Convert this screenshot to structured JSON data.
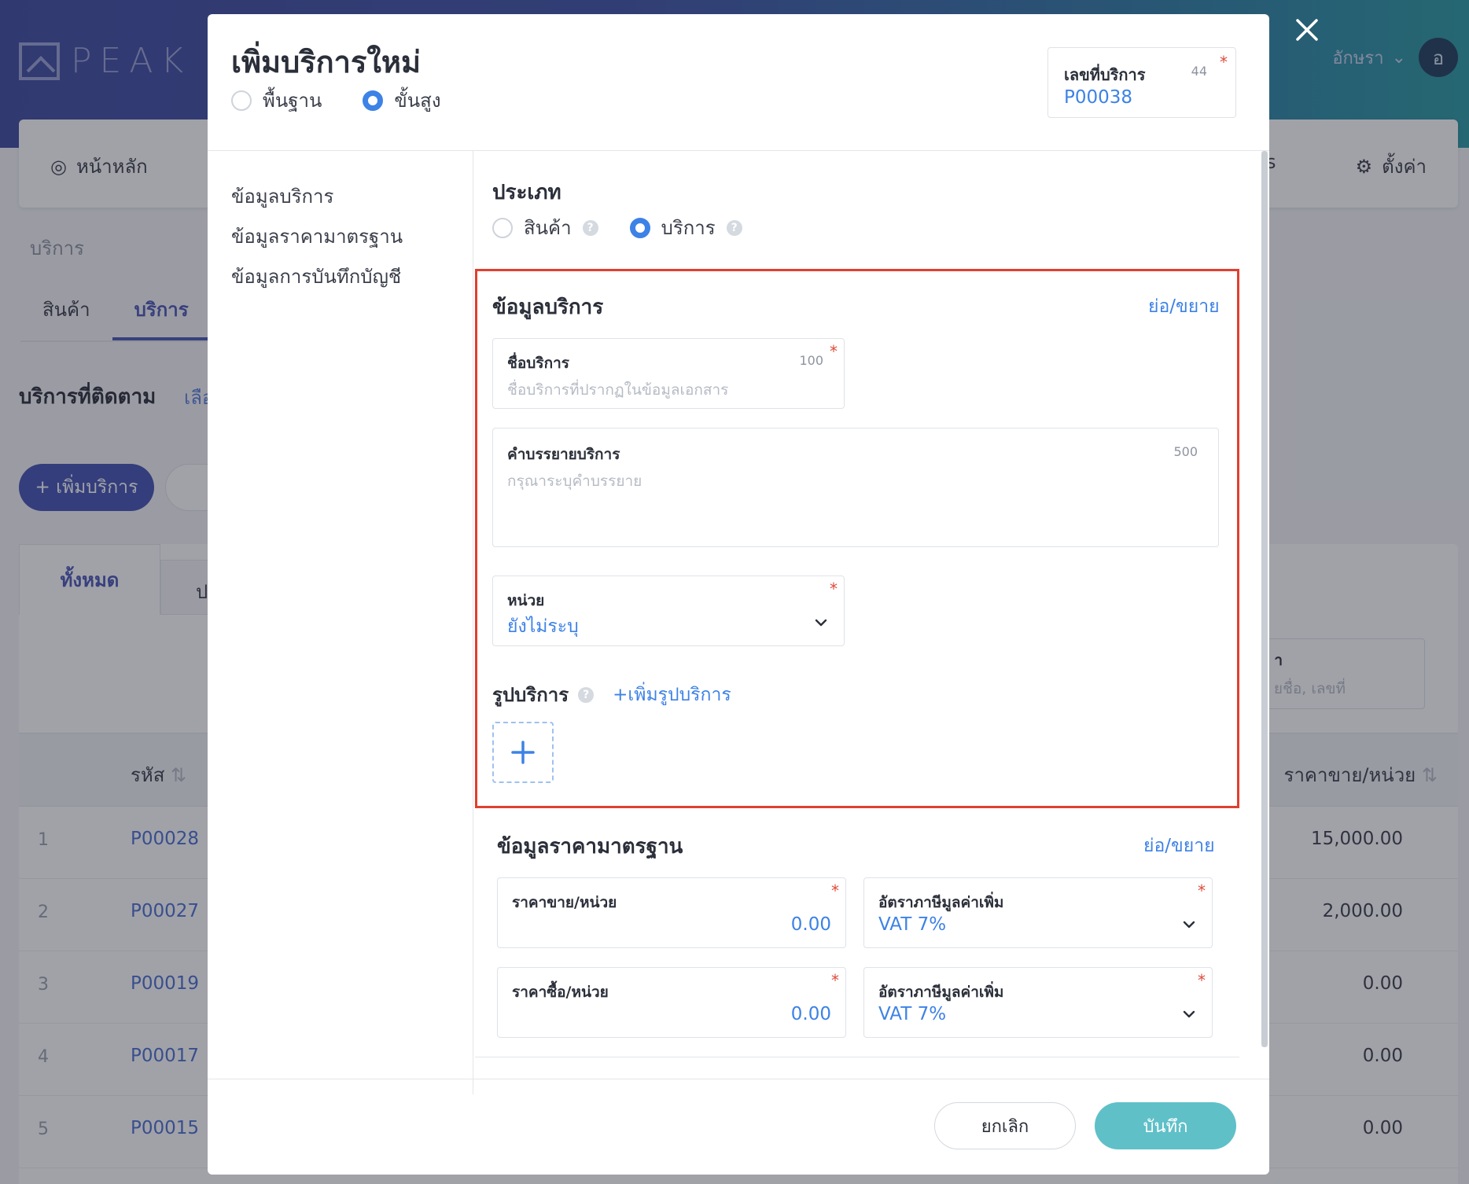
{
  "background": {
    "logo_text": "PEAK",
    "user_name": "อักษรา",
    "avatar_letter": "อ",
    "nav_home": "หน้าหลัก",
    "nav_settings": "ตั้งค่า",
    "nav_partial": "s",
    "breadcrumb": "บริการ",
    "tabs": [
      "สินค้า",
      "บริการ"
    ],
    "followed_title": "บริการที่ติดตาม",
    "followed_link": "เลือ",
    "add_button": "+ เพิ่มบริการ",
    "subtab_all": "ทั้งหมด",
    "subtab_partial": "ป",
    "search_partial_label": "า",
    "search_partial_placeholder": "ยชื่อ, เลขที่",
    "table_head_code": "รหัส",
    "table_head_price": "ราคาขาย/หน่วย",
    "rows": [
      {
        "idx": "1",
        "code": "P00028",
        "price": "15,000.00"
      },
      {
        "idx": "2",
        "code": "P00027",
        "price": "2,000.00"
      },
      {
        "idx": "3",
        "code": "P00019",
        "price": "0.00"
      },
      {
        "idx": "4",
        "code": "P00017",
        "price": "0.00"
      },
      {
        "idx": "5",
        "code": "P00015",
        "price": "0.00"
      }
    ]
  },
  "modal": {
    "title": "เพิ่มบริการใหม่",
    "mode_basic": "พื้นฐาน",
    "mode_advanced": "ขั้นสูง",
    "mode_selected": "advanced",
    "doc_number_label": "เลขที่บริการ",
    "doc_number_count": "44",
    "doc_number_value": "P00038",
    "side_nav": [
      "ข้อมูลบริการ",
      "ข้อมูลราคามาตรฐาน",
      "ข้อมูลการบันทึกบัญชี"
    ],
    "type_title": "ประเภท",
    "type_product": "สินค้า",
    "type_service": "บริการ",
    "type_selected": "service",
    "service_section": {
      "title": "ข้อมูลบริการ",
      "toggle": "ย่อ/ขยาย",
      "name_label": "ชื่อบริการ",
      "name_count": "100",
      "name_placeholder": "ชื่อบริการที่ปรากฏในข้อมูลเอกสาร",
      "desc_label": "คำบรรยายบริการ",
      "desc_count": "500",
      "desc_placeholder": "กรุณาระบุคำบรรยาย",
      "unit_label": "หน่วย",
      "unit_value": "ยังไม่ระบุ",
      "image_label": "รูปบริการ",
      "image_add": "+เพิ่มรูปบริการ"
    },
    "price_section": {
      "title": "ข้อมูลราคามาตรฐาน",
      "toggle": "ย่อ/ขยาย",
      "sell_label": "ราคาขาย/หน่วย",
      "sell_value": "0.00",
      "sell_vat_label": "อัตราภาษีมูลค่าเพิ่ม",
      "sell_vat_value": "VAT 7%",
      "buy_label": "ราคาซื้อ/หน่วย",
      "buy_value": "0.00",
      "buy_vat_label": "อัตราภาษีมูลค่าเพิ่ม",
      "buy_vat_value": "VAT 7%"
    },
    "required_mark": "*",
    "help_mark": "?",
    "cancel_button": "ยกเลิก",
    "save_button": "บันทึก"
  },
  "colors": {
    "accent_blue": "#3d82e6",
    "brand_indigo": "#4453b4",
    "save_teal": "#5fc0c8",
    "highlight_red": "#e0402f",
    "required_red": "#e04a3a"
  }
}
